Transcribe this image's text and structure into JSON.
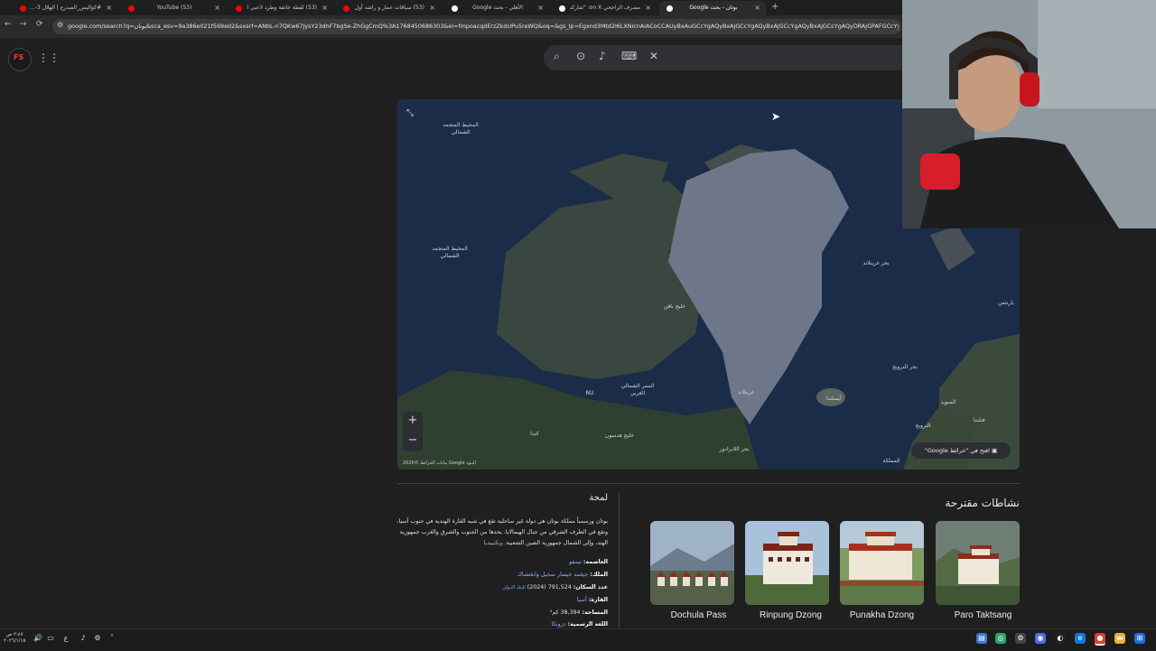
{
  "tabs": [
    {
      "title": "#كواليس_الصدرع | الهلال 3-...",
      "active": false,
      "favicon_color": "#ff0000"
    },
    {
      "title": "(53) YouTube",
      "active": false,
      "favicon_color": "#ff0000"
    },
    {
      "title": "(53) لقطة خاتفة وطرد لاعبي الت...",
      "active": false,
      "favicon_color": "#ff0000"
    },
    {
      "title": "(53) سباقات عمار و راشد أول مرة...",
      "active": false,
      "favicon_color": "#ff0000"
    },
    {
      "title": "الأهلي - بحث Google",
      "active": false,
      "favicon_color": "#ffffff"
    },
    {
      "title": "مصرف الراجحي on X: \"شاركنا لحـ...",
      "active": false,
      "favicon_color": "#ffffff"
    },
    {
      "title": "بوتان - بحث Google",
      "active": true,
      "favicon_color": "#ffffff"
    }
  ],
  "tab_close": "×",
  "new_tab": "+",
  "toolbar": {
    "back": "←",
    "forward": "→",
    "reload": "⟳",
    "url": "google.com/search?q=بوتان&sca_esv=9a386e021f569ed2&sxsrf=ANbL-n7QKw67JysY23dhF7bgSe-ZhGgCmQ%3A1768450686303&ei=fmpoacqdErzZkdUPu5reWQ&oq=&gs_lp=Egxnd3Mtd2l6LXNlcnAiACoCCAUyBxAuGCcYgAQyBxAjGCcYgAQyBxAjGCcYgAQyBxAjGCcYgAQyDRAjGPAFGCcYyQIYgAQyBxAj"
  },
  "header": {
    "logo_text": "FS",
    "apps_icon": "apps-grid-icon"
  },
  "search_bar": {
    "icons": [
      "search-icon",
      "lens-icon",
      "mic-icon",
      "keyboard-icon",
      "close-icon"
    ]
  },
  "map": {
    "labels": [
      {
        "text": "المحيط المتجمد الشمالي"
      },
      {
        "text": "المحيط المتجمد الشمالي"
      },
      {
        "text": "بحر غرينلاند"
      },
      {
        "text": "خليج بافن"
      },
      {
        "text": "بحر النرويج"
      },
      {
        "text": "بارنتس"
      },
      {
        "text": "غرينلاند"
      },
      {
        "text": "آيسلندا"
      },
      {
        "text": "الممر الشمالي الغربي"
      },
      {
        "text": "NU"
      },
      {
        "text": "كندا"
      },
      {
        "text": "خليج هدسون"
      },
      {
        "text": "بحر اللابرادور"
      },
      {
        "text": "السويد"
      },
      {
        "text": "فنلندا"
      },
      {
        "text": "النرويج"
      },
      {
        "text": "المملكة"
      }
    ],
    "zoom_in": "+",
    "zoom_out": "−",
    "open_in_maps": "افتح في \"خرائط Google\"",
    "attribution": "بيانات الخرائط ©2026 Google   البنود"
  },
  "overview": {
    "title": "لمحة",
    "text": "بوتان ورسمياً مملكة بوتان هي دولة غير ساحلية تقع في شبه القارة الهندية في جنوب آسيا، وتقع في الطرف الشرقي من جبال الهيمالايا. يحدها من الجنوب والشرق والغرب جمهورية الهند، وإلى الشمال جمهورية الصين الشعبية.",
    "wiki_link": "ويكيبيديا",
    "facts": [
      {
        "label": "العاصمة:",
        "value": "تيمفو",
        "extra": ""
      },
      {
        "label": "الملك:",
        "value": "جيغمه خيسار نمجيل وانغتشاك",
        "extra": ""
      },
      {
        "label": "عدد السكان:",
        "value": "791,524 (2024)",
        "extra": "البنك الدولي"
      },
      {
        "label": "القارة:",
        "value": "آسيا",
        "extra": ""
      },
      {
        "label": "المساحة:",
        "value": "38,394 كم²",
        "extra": ""
      },
      {
        "label": "اللغة الرسمية:",
        "value": "دزونكا",
        "extra": ""
      }
    ]
  },
  "activities": {
    "title": "نشاطات مقترحة",
    "cards": [
      {
        "label": "Dochula Pass"
      },
      {
        "label": "Rinpung Dzong"
      },
      {
        "label": "Punakha Dzong"
      },
      {
        "label": "Paro Taktsang"
      }
    ]
  },
  "taskbar": {
    "time": "٢:٤٧ ص",
    "date": "٢٠٢٦/١/١٥",
    "lang": "ع"
  }
}
